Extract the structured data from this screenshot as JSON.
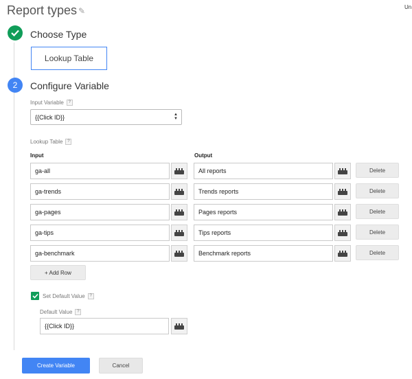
{
  "header": {
    "title": "Report types",
    "edit_icon": "pencil-icon",
    "top_right_text": "Un"
  },
  "steps": {
    "choose_type": {
      "label": "Choose Type",
      "selected_type": "Lookup Table"
    },
    "configure_variable": {
      "number": "2",
      "label": "Configure Variable"
    }
  },
  "input_variable": {
    "label": "Input Variable",
    "help": "?",
    "value": "{{Click ID}}"
  },
  "lookup_table": {
    "label": "Lookup Table",
    "help": "?",
    "input_header": "Input",
    "output_header": "Output",
    "rows": [
      {
        "input": "ga-all",
        "output": "All reports",
        "delete_label": "Delete"
      },
      {
        "input": "ga-trends",
        "output": "Trends reports",
        "delete_label": "Delete"
      },
      {
        "input": "ga-pages",
        "output": "Pages reports",
        "delete_label": "Delete"
      },
      {
        "input": "ga-tips",
        "output": "Tips reports",
        "delete_label": "Delete"
      },
      {
        "input": "ga-benchmark",
        "output": "Benchmark reports",
        "delete_label": "Delete"
      }
    ],
    "add_row_label": "+ Add Row"
  },
  "default_value": {
    "checkbox_label": "Set Default Value",
    "checkbox_help": "?",
    "checked": true,
    "field_label": "Default Value",
    "field_help": "?",
    "value": "{{Click ID}}"
  },
  "actions": {
    "create_label": "Create Variable",
    "cancel_label": "Cancel"
  },
  "colors": {
    "accent_blue": "#4285f4",
    "success_green": "#109d59"
  }
}
